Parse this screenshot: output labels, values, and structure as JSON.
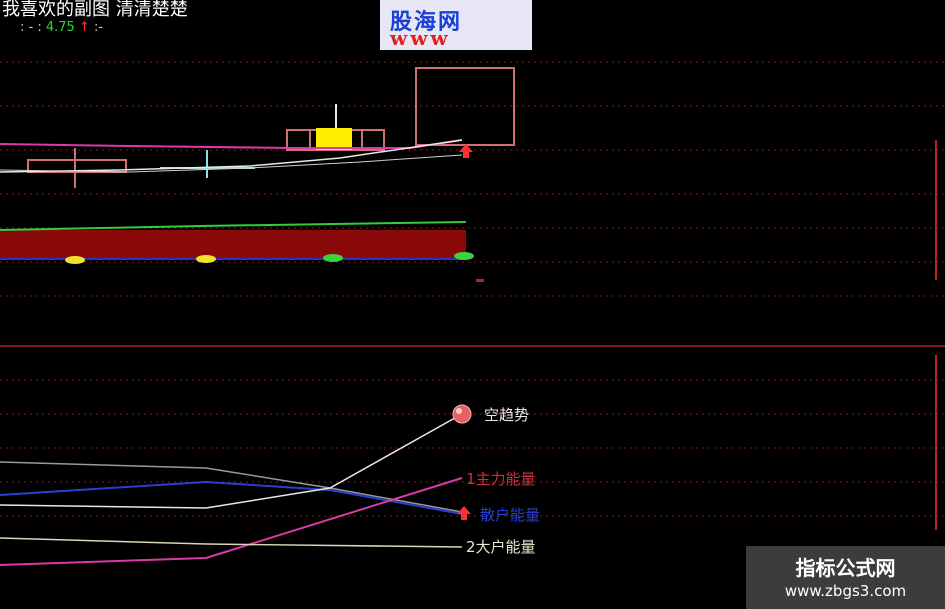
{
  "header": {
    "title": "我喜欢的副图  清清楚楚",
    "readout_prefix": ": - :",
    "readout_value": "4.75",
    "readout_arrow": "↑",
    "readout_suffix": ":-"
  },
  "logo": {
    "text": "股海网",
    "subtext": "www"
  },
  "labels": {
    "trend": "空趋势",
    "main_energy": "1主力能量",
    "retail_energy": "散户能量",
    "big_energy": "2大户能量"
  },
  "watermark": {
    "title": "指标公式网",
    "url": "www.zbgs3.com"
  },
  "colors": {
    "background": "#000000",
    "grid": "#a01818",
    "magenta": "#d93aa8",
    "white_line": "#e8e8e8",
    "blue_line": "#2a3fd0",
    "green_line": "#2fcf3a",
    "dark_red_fill": "#8a0a0a",
    "yellow_candle": "#ffee00"
  }
}
